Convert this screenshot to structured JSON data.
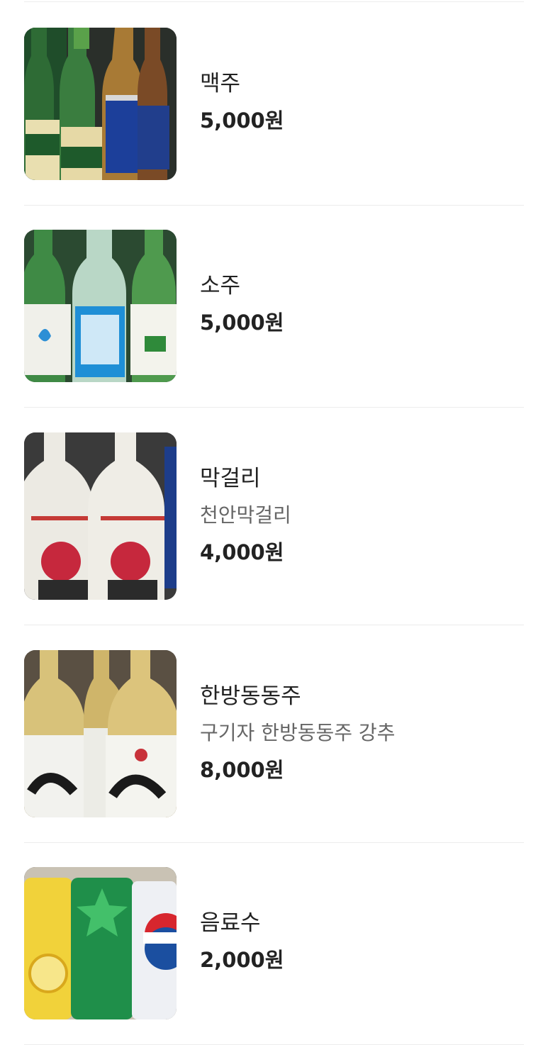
{
  "menu": {
    "items": [
      {
        "name": "맥주",
        "description": "",
        "price": "5,000원",
        "image": "beer-bottles-photo"
      },
      {
        "name": "소주",
        "description": "",
        "price": "5,000원",
        "image": "soju-bottles-photo"
      },
      {
        "name": "막걸리",
        "description": "천안막걸리",
        "price": "4,000원",
        "image": "makgeolli-bottles-photo"
      },
      {
        "name": "한방동동주",
        "description": "구기자 한방동동주 강추",
        "price": "8,000원",
        "image": "dongdongju-bottles-photo"
      },
      {
        "name": "음료수",
        "description": "",
        "price": "2,000원",
        "image": "soda-cans-photo"
      }
    ]
  }
}
